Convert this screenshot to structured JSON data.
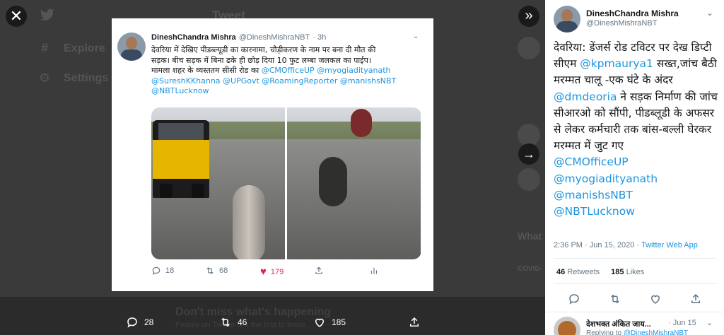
{
  "backdrop": {
    "nav_items": [
      {
        "icon": "hashtag-icon",
        "glyph": "#",
        "label": "Explore"
      },
      {
        "icon": "gear-icon",
        "glyph": "⚙",
        "label": "Settings"
      }
    ],
    "top_label": "Tweet",
    "right_heading": "What",
    "right_caption": "COVID-",
    "banner_title": "Don't miss what's happening",
    "banner_subtitle": "People on Twitter are the first to know."
  },
  "controls": {
    "close_glyph": "✕",
    "expand_glyph": "»",
    "next_glyph": "→"
  },
  "bottom_actions": {
    "replies": "28",
    "retweets": "46",
    "likes": "185"
  },
  "media_tweet": {
    "name": "DineshChandra Mishra",
    "handle": "@DineshMishraNBT",
    "time": "· 3h",
    "caret": "⌄",
    "text_lines": [
      "देवरिया में देखिए पीडब्ल्यूडी का कारनामा, चौड़ीकरण के नाम पर बना दी मौत की",
      "सड़क। बीच सड़क में बिना ढके ही छोड़ दिया 10 फुट लम्बा जलकल का पाईप।",
      "मामला शहर के व्यस्ततम सीसी रोड का"
    ],
    "mentions_line1": " @CMOfficeUP @myogiadityanath",
    "mentions_line2": "@SureshKKhanna @UPGovt @RoamingReporter @manishsNBT",
    "mentions_line3": "@NBTLucknow",
    "replies": "18",
    "retweets": "68",
    "likes": "179"
  },
  "tweet": {
    "name": "DineshChandra Mishra",
    "handle": "@DineshMishraNBT",
    "caret": "⌄",
    "text_1": "देवरिया: डेंजर्स रोड टविटर पर देख डिप्टी सीएम ",
    "link_1": "@kpmaurya1",
    "text_2": " सख्त,जांच बैठी मरम्मत चालू -एक घंटे के अंदर ",
    "link_2": "@dmdeoria",
    "text_3": "  ने सड़क निर्माण की जांच सीआरओ को सौंपी, पीडब्लूडी के अफसर से लेकर कर्मचारी तक बांस-बल्ली घेरकर मरम्मत में जुट गए",
    "link_3": "@CMOfficeUP",
    "link_4": "@myogiadityanath",
    "link_5": "@manishsNBT",
    "link_6": "@NBTLucknow",
    "timestamp": "2:36 PM · Jun 15, 2020 · ",
    "source": "Twitter Web App",
    "retweets_count": "46",
    "retweets_label": "Retweets",
    "likes_count": "185",
    "likes_label": "Likes"
  },
  "reply": {
    "name": "देशभक्त अंकित जाय...",
    "date": "· Jun 15",
    "caret": "⌄",
    "replying_prefix": "Replying to ",
    "replying_handle": "@DineshMishraNBT"
  },
  "colors": {
    "accent": "#1b95e0",
    "like": "#e0245e",
    "muted": "#657786"
  }
}
